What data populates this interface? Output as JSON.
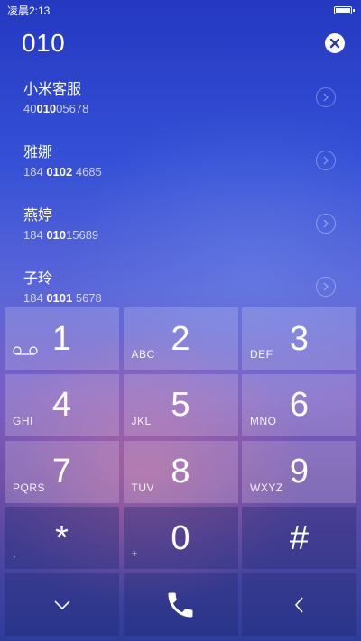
{
  "status_bar": {
    "time": "凌晨2:13"
  },
  "dialer": {
    "number": "010"
  },
  "contacts": [
    {
      "name": "小米客服",
      "phone_pre": "40",
      "phone_match": "010",
      "phone_post": "05678"
    },
    {
      "name": "雅娜",
      "phone_pre": "184 ",
      "phone_match": "0102",
      "phone_post": " 4685"
    },
    {
      "name": "燕婷",
      "phone_pre": "184 ",
      "phone_match": "010",
      "phone_post": "15689"
    },
    {
      "name": "子玲",
      "phone_pre": "184 ",
      "phone_match": "0101",
      "phone_post": " 5678"
    }
  ],
  "keypad": [
    {
      "digit": "1",
      "letters": ""
    },
    {
      "digit": "2",
      "letters": "ABC"
    },
    {
      "digit": "3",
      "letters": "DEF"
    },
    {
      "digit": "4",
      "letters": "GHI"
    },
    {
      "digit": "5",
      "letters": "JKL"
    },
    {
      "digit": "6",
      "letters": "MNO"
    },
    {
      "digit": "7",
      "letters": "PQRS"
    },
    {
      "digit": "8",
      "letters": "TUV"
    },
    {
      "digit": "9",
      "letters": "WXYZ"
    },
    {
      "digit": "*",
      "letters": ","
    },
    {
      "digit": "0",
      "letters": "+"
    },
    {
      "digit": "#",
      "letters": ""
    }
  ],
  "icons": {
    "clear": "close-circle-icon",
    "voicemail": "voicemail-icon",
    "collapse": "chevron-down-icon",
    "call": "phone-icon",
    "backspace": "chevron-left-icon"
  }
}
